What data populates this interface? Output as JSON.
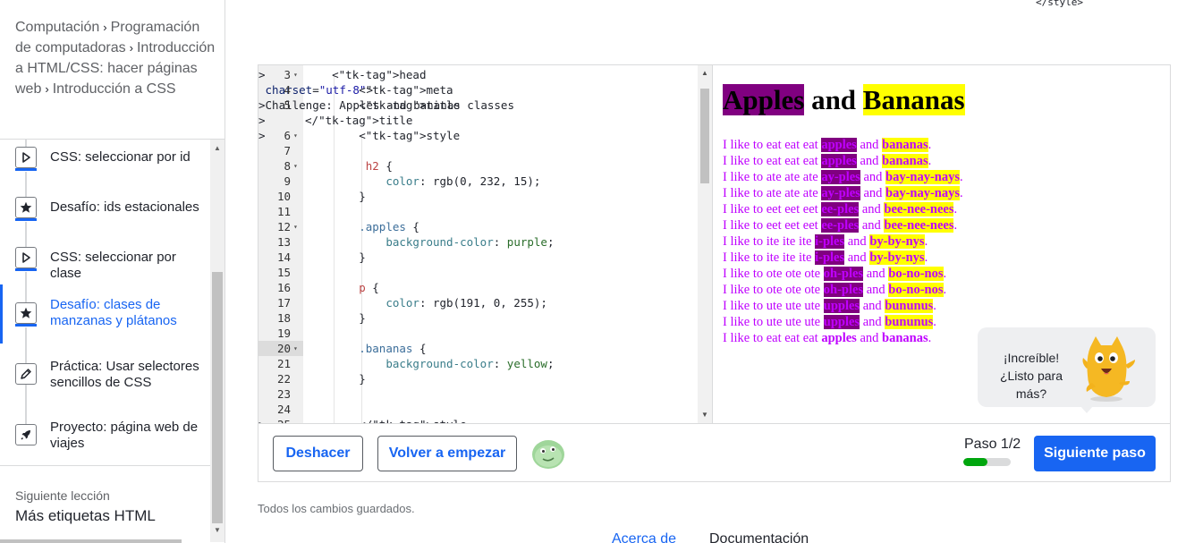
{
  "breadcrumb": {
    "items": [
      "Computación",
      "Programación de computadoras",
      "Introducción a HTML/CSS: hacer páginas web",
      "Introducción a CSS"
    ],
    "sep": "›"
  },
  "lessons": [
    {
      "label": "CSS: seleccionar por id",
      "icon": "play-icon"
    },
    {
      "label": "Desafío: ids estacionales",
      "icon": "star-icon"
    },
    {
      "label": "CSS: seleccionar por clase",
      "icon": "play-icon"
    },
    {
      "label": "Desafío: clases de manzanas y plátanos",
      "icon": "star-icon",
      "active": true
    },
    {
      "label": "Práctica: Usar selectores sencillos de CSS",
      "icon": "pencil-icon"
    },
    {
      "label": "Proyecto: página web de viajes",
      "icon": "rocket-icon"
    }
  ],
  "next_lesson": {
    "caption": "Siguiente lección",
    "title": "Más etiquetas HTML"
  },
  "top_snippet": "</style>",
  "code": {
    "current_line": 20,
    "lines": [
      {
        "n": "3",
        "fold": true,
        "text": "    <head>"
      },
      {
        "n": "4",
        "fold": false,
        "text": "        <meta charset=\"utf-8\">"
      },
      {
        "n": "5",
        "fold": false,
        "text": "        <title>Challenge: Apples and bananas classes"
      },
      {
        "n": "",
        "fold": false,
        "text": "</title>"
      },
      {
        "n": "6",
        "fold": true,
        "text": "        <style>"
      },
      {
        "n": "7",
        "fold": false,
        "text": ""
      },
      {
        "n": "8",
        "fold": true,
        "text": "         h2 {"
      },
      {
        "n": "9",
        "fold": false,
        "text": "            color: rgb(0, 232, 15);"
      },
      {
        "n": "10",
        "fold": false,
        "text": "        }"
      },
      {
        "n": "11",
        "fold": false,
        "text": ""
      },
      {
        "n": "12",
        "fold": true,
        "text": "        .apples {"
      },
      {
        "n": "13",
        "fold": false,
        "text": "            background-color: purple;"
      },
      {
        "n": "14",
        "fold": false,
        "text": "        }"
      },
      {
        "n": "15",
        "fold": false,
        "text": ""
      },
      {
        "n": "16",
        "fold": false,
        "text": "        p {"
      },
      {
        "n": "17",
        "fold": false,
        "text": "            color: rgb(191, 0, 255);"
      },
      {
        "n": "18",
        "fold": false,
        "text": "        }"
      },
      {
        "n": "19",
        "fold": false,
        "text": ""
      },
      {
        "n": "20",
        "fold": true,
        "text": "        .bananas {"
      },
      {
        "n": "21",
        "fold": false,
        "text": "            background-color: yellow;"
      },
      {
        "n": "22",
        "fold": false,
        "text": "        }"
      },
      {
        "n": "23",
        "fold": false,
        "text": ""
      },
      {
        "n": "24",
        "fold": false,
        "text": ""
      },
      {
        "n": "25",
        "fold": true,
        "text": "        </style>"
      }
    ]
  },
  "preview": {
    "heading": {
      "apples": "Apples",
      "and": " and ",
      "bananas": "Bananas"
    },
    "lines": [
      {
        "pre": "I like to eat eat eat ",
        "a": "apples",
        "mid": " and ",
        "b": "bananas",
        "post": ".",
        "hl": true
      },
      {
        "pre": "I like to eat eat eat ",
        "a": "apples",
        "mid": " and ",
        "b": "bananas",
        "post": ".",
        "hl": true
      },
      {
        "pre": "I like to ate ate ate ",
        "a": "ay-ples",
        "mid": " and ",
        "b": "bay-nay-nays",
        "post": ".",
        "hl": true
      },
      {
        "pre": "I like to ate ate ate ",
        "a": "ay-ples",
        "mid": " and ",
        "b": "bay-nay-nays",
        "post": ".",
        "hl": true
      },
      {
        "pre": "I like to eet eet eet ",
        "a": "ee-ples",
        "mid": " and ",
        "b": "bee-nee-nees",
        "post": ".",
        "hl": true
      },
      {
        "pre": "I like to eet eet eet ",
        "a": "ee-ples",
        "mid": " and ",
        "b": "bee-nee-nees",
        "post": ".",
        "hl": true
      },
      {
        "pre": "I like to ite ite ite ",
        "a": "i-ples",
        "mid": " and ",
        "b": "by-by-nys",
        "post": ".",
        "hl": true
      },
      {
        "pre": "I like to ite ite ite ",
        "a": "i-ples",
        "mid": " and ",
        "b": "by-by-nys",
        "post": ".",
        "hl": true
      },
      {
        "pre": "I like to ote ote ote ",
        "a": "oh-ples",
        "mid": " and ",
        "b": "bo-no-nos",
        "post": ".",
        "hl": true
      },
      {
        "pre": "I like to ote ote ote ",
        "a": "oh-ples",
        "mid": " and ",
        "b": "bo-no-nos",
        "post": ".",
        "hl": true
      },
      {
        "pre": "I like to ute ute ute ",
        "a": "upples",
        "mid": " and ",
        "b": "bununus",
        "post": ".",
        "hl": true
      },
      {
        "pre": "I like to ute ute ute ",
        "a": "upples",
        "mid": " and ",
        "b": "bununus",
        "post": ".",
        "hl": true
      },
      {
        "pre": "I like to eat eat eat ",
        "a": "apples",
        "mid": " and ",
        "b": "bananas",
        "post": ".",
        "hl": false
      }
    ]
  },
  "toast": {
    "text": "¡Increíble! ¿Listo para más?"
  },
  "footer": {
    "undo": "Deshacer",
    "restart": "Volver a empezar",
    "step_label": "Paso 1/2",
    "step_progress": 0.5,
    "next_step": "Siguiente paso"
  },
  "saved_status": "Todos los cambios guardados.",
  "footer_links": [
    "Acerca de",
    "Documentación"
  ],
  "colors": {
    "accent": "#1865f2",
    "progress": "#00a60e",
    "apples_bg": "#800080",
    "bananas_bg": "#ffff00",
    "p_color": "#bf00ff"
  }
}
